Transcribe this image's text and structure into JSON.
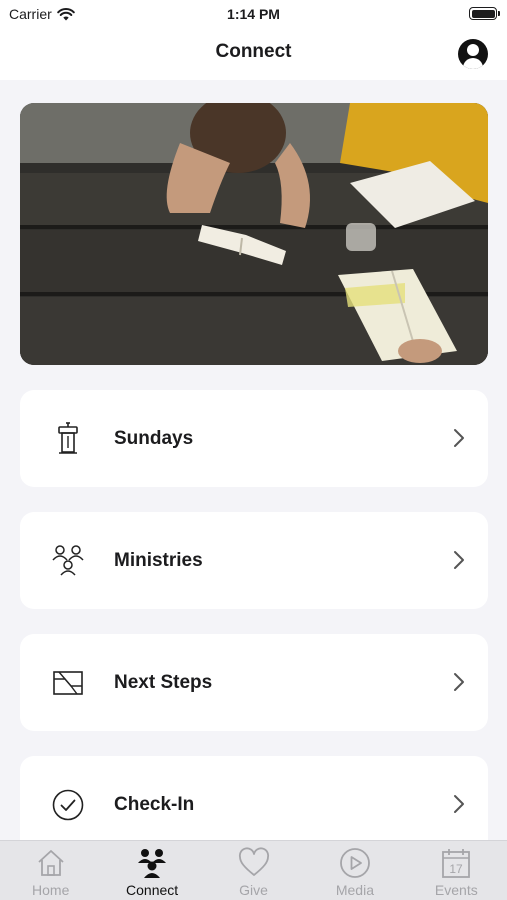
{
  "status_bar": {
    "carrier": "Carrier",
    "time": "1:14 PM"
  },
  "nav": {
    "title": "Connect",
    "profile_icon": "profile-icon"
  },
  "hero": {
    "image": "people reading books at a wooden picnic table"
  },
  "menu": [
    {
      "label": "Sundays",
      "icon": "podium-icon"
    },
    {
      "label": "Ministries",
      "icon": "group-icon"
    },
    {
      "label": "Next Steps",
      "icon": "steps-icon"
    },
    {
      "label": "Check-In",
      "icon": "check-circle-icon"
    }
  ],
  "tabs": [
    {
      "label": "Home",
      "icon": "home-icon",
      "active": false
    },
    {
      "label": "Connect",
      "icon": "people-icon",
      "active": true
    },
    {
      "label": "Give",
      "icon": "heart-icon",
      "active": false
    },
    {
      "label": "Media",
      "icon": "play-icon",
      "active": false
    },
    {
      "label": "Events",
      "icon": "calendar-icon",
      "active": false
    }
  ],
  "colors": {
    "background": "#f4f4f8",
    "card": "#ffffff",
    "text": "#1c1c1e",
    "tab_inactive": "#a5a5a9",
    "tab_active": "#111111",
    "tabbar": "#e5e5e8"
  }
}
